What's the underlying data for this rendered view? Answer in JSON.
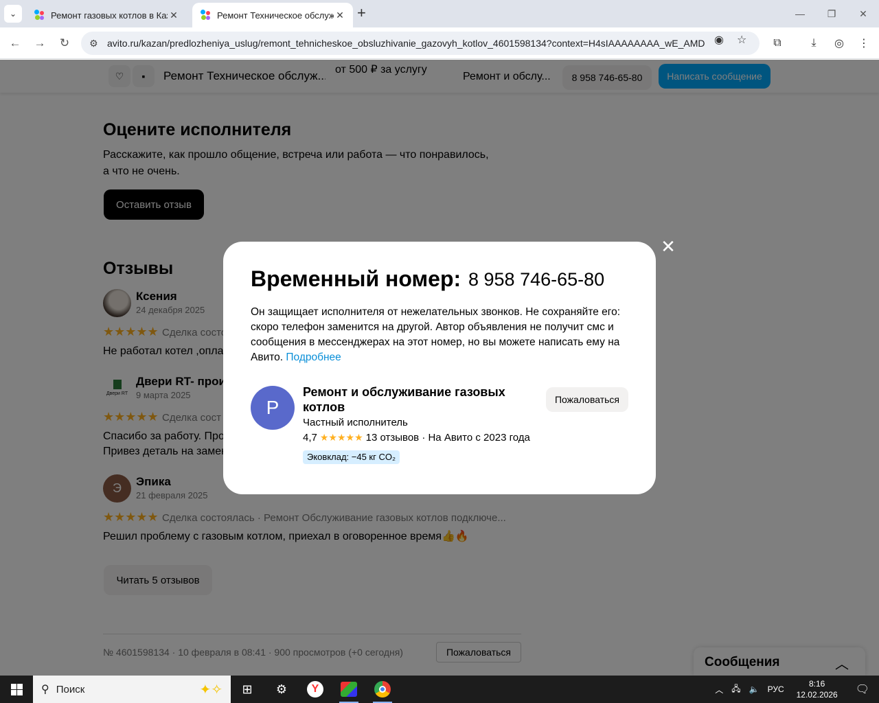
{
  "browser": {
    "tabs": [
      {
        "title": "Ремонт газовых котлов в Каза",
        "active": false
      },
      {
        "title": "Ремонт Техническое обслужи",
        "active": true
      }
    ],
    "url": "avito.ru/kazan/predlozheniya_uslug/remont_tehnicheskoe_obsluzhivanie_gazovyh_kotlov_4601598134?context=H4sIAAAAAAAA_wE_AMD_..."
  },
  "sticky_header": {
    "title": "Ремонт Техническое обслуж...",
    "price": "от 500 ₽ за услугу",
    "seller": "Ремонт и обслу...",
    "phone_button": "8 958 746-65-80",
    "message_button": "Написать сообщение"
  },
  "rate_section": {
    "heading": "Оцените исполнителя",
    "text_line1": "Расскажите, как прошло общение, встреча или работа — что понравилось,",
    "text_line2": "а что не очень.",
    "button": "Оставить отзыв"
  },
  "reviews_section": {
    "heading": "Отзывы",
    "items": [
      {
        "name": "Ксения",
        "date": "24 декабря 2025",
        "stars": "★★★★★",
        "meta": "Сделка состо",
        "body": "Не работал котел ,оплат",
        "avatar_letter": ""
      },
      {
        "name": "Двери RT- произ",
        "date": "9 марта 2025",
        "stars": "★★★★★",
        "meta": "Сделка сост",
        "body_line1": "Спасибо за работу. Пров",
        "body_line2": "Привез деталь на замен",
        "avatar_letter": "",
        "avatar_caption": "Двери RT"
      },
      {
        "name": "Эпика",
        "date": "21 февраля 2025",
        "stars": "★★★★★",
        "meta": "Сделка состоялась · Ремонт Обслуживание газовых котлов подключе...",
        "body": "Решил проблему с газовым котлом, приехал в оговоренное время👍🔥",
        "avatar_letter": "Э"
      }
    ],
    "read_more_button": "Читать 5 отзывов"
  },
  "footer": {
    "info": "№ 4601598134 · 10 февраля в 08:41 · 900 просмотров (+0 сегодня)",
    "report_button": "Пожаловаться"
  },
  "messages_widget": {
    "label": "Сообщения"
  },
  "modal": {
    "title": "Временный номер:",
    "phone": "8 958 746-65-80",
    "text": "Он защищает исполнителя от нежелательных звонков. Не сохраняйте его: скоро телефон заменится на другой. Автор объявления не получит смс и сообщения в мессенджерах на этот номер, но вы можете написать ему на Авито.",
    "link": "Подробнее",
    "avatar_letter": "Р",
    "seller_name": "Ремонт и обслуживание газовых котлов",
    "seller_type": "Частный исполнитель",
    "rating": "4,7",
    "rating_stars": "★★★★★",
    "reviews_count": "13 отзывов",
    "since": "· На Авито с 2023 года",
    "eco": "Эковклад: −45 кг CO₂",
    "report_button": "Пожаловаться"
  },
  "taskbar": {
    "search_placeholder": "Поиск",
    "language": "РУС",
    "time": "8:16",
    "date": "12.02.2026"
  },
  "colors": {
    "accent": "#00aaff",
    "star": "#ffb021",
    "avatar_modal": "#5969cb",
    "eco_badge": "#d6eeff"
  }
}
